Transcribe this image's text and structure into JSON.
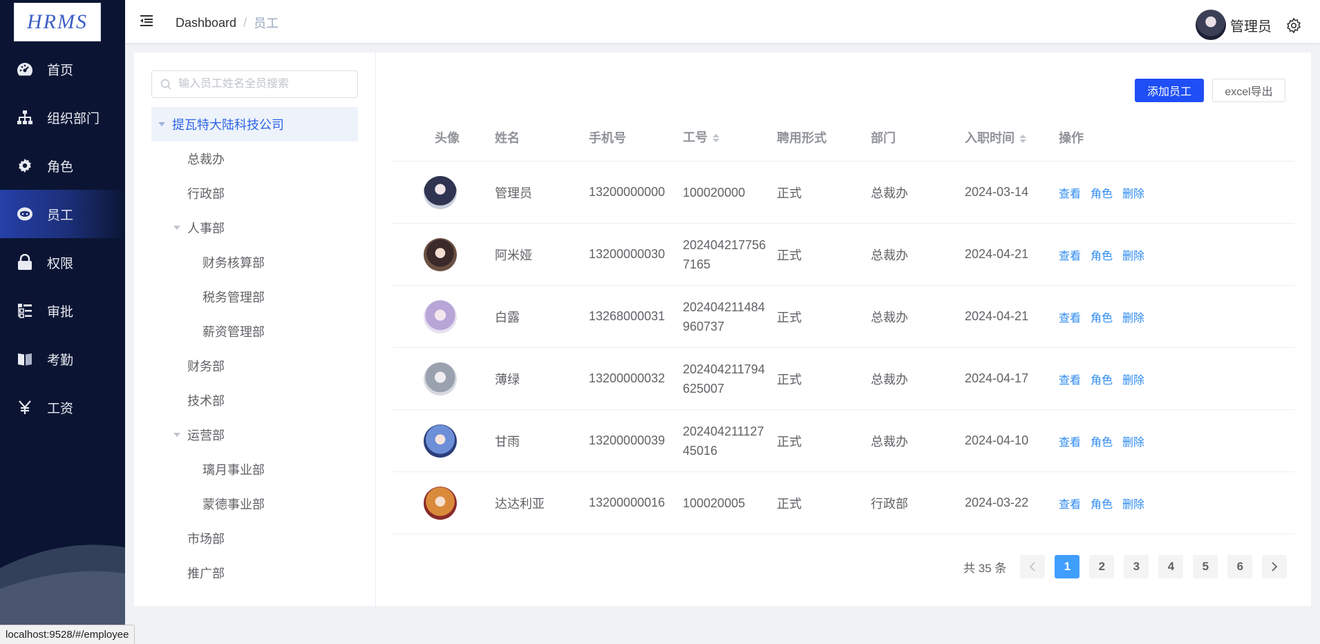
{
  "logo": {
    "text": "HRMS"
  },
  "sidebar": {
    "items": [
      {
        "label": "首页",
        "icon": "dashboard-icon"
      },
      {
        "label": "组织部门",
        "icon": "org-tree-icon"
      },
      {
        "label": "角色",
        "icon": "gear-icon"
      },
      {
        "label": "员工",
        "icon": "employee-icon",
        "active": true
      },
      {
        "label": "权限",
        "icon": "lock-icon"
      },
      {
        "label": "审批",
        "icon": "list-icon"
      },
      {
        "label": "考勤",
        "icon": "book-icon"
      },
      {
        "label": "工资",
        "icon": "yen-icon"
      }
    ]
  },
  "header": {
    "breadcrumb": {
      "home": "Dashboard",
      "sep": "/",
      "current": "员工"
    },
    "user_name": "管理员"
  },
  "search": {
    "placeholder": "输入员工姓名全员搜索"
  },
  "tree": {
    "root": "提瓦特大陆科技公司",
    "nodes": [
      {
        "label": "总裁办",
        "level": 1
      },
      {
        "label": "行政部",
        "level": 1
      },
      {
        "label": "人事部",
        "level": 1,
        "expanded": true
      },
      {
        "label": "财务核算部",
        "level": 2
      },
      {
        "label": "税务管理部",
        "level": 2
      },
      {
        "label": "薪资管理部",
        "level": 2
      },
      {
        "label": "财务部",
        "level": 1
      },
      {
        "label": "技术部",
        "level": 1
      },
      {
        "label": "运营部",
        "level": 1,
        "expanded": true
      },
      {
        "label": "璃月事业部",
        "level": 2
      },
      {
        "label": "蒙德事业部",
        "level": 2
      },
      {
        "label": "市场部",
        "level": 1
      },
      {
        "label": "推广部",
        "level": 1
      }
    ]
  },
  "actions": {
    "add": "添加员工",
    "export": "excel导出"
  },
  "table": {
    "headers": [
      "头像",
      "姓名",
      "手机号",
      "工号",
      "聘用形式",
      "部门",
      "入职时间",
      "操作"
    ],
    "rows": [
      {
        "name": "管理员",
        "phone": "13200000000",
        "id": "100020000",
        "type": "正式",
        "dept": "总裁办",
        "date": "2024-03-14"
      },
      {
        "name": "阿米娅",
        "phone": "13200000030",
        "id": "2024042177567165",
        "type": "正式",
        "dept": "总裁办",
        "date": "2024-04-21"
      },
      {
        "name": "白露",
        "phone": "13268000031",
        "id": "202404211484960737",
        "type": "正式",
        "dept": "总裁办",
        "date": "2024-04-21"
      },
      {
        "name": "薄绿",
        "phone": "13200000032",
        "id": "202404211794625007",
        "type": "正式",
        "dept": "总裁办",
        "date": "2024-04-17"
      },
      {
        "name": "甘雨",
        "phone": "13200000039",
        "id": "20240421112745016",
        "type": "正式",
        "dept": "总裁办",
        "date": "2024-04-10"
      },
      {
        "name": "达达利亚",
        "phone": "13200000016",
        "id": "100020005",
        "type": "正式",
        "dept": "行政部",
        "date": "2024-03-22"
      }
    ],
    "ops": {
      "view": "查看",
      "role": "角色",
      "delete": "删除"
    }
  },
  "pagination": {
    "total": "共 35 条",
    "pages": [
      "1",
      "2",
      "3",
      "4",
      "5",
      "6"
    ],
    "current": "1"
  },
  "status_url": "localhost:9528/#/employee"
}
